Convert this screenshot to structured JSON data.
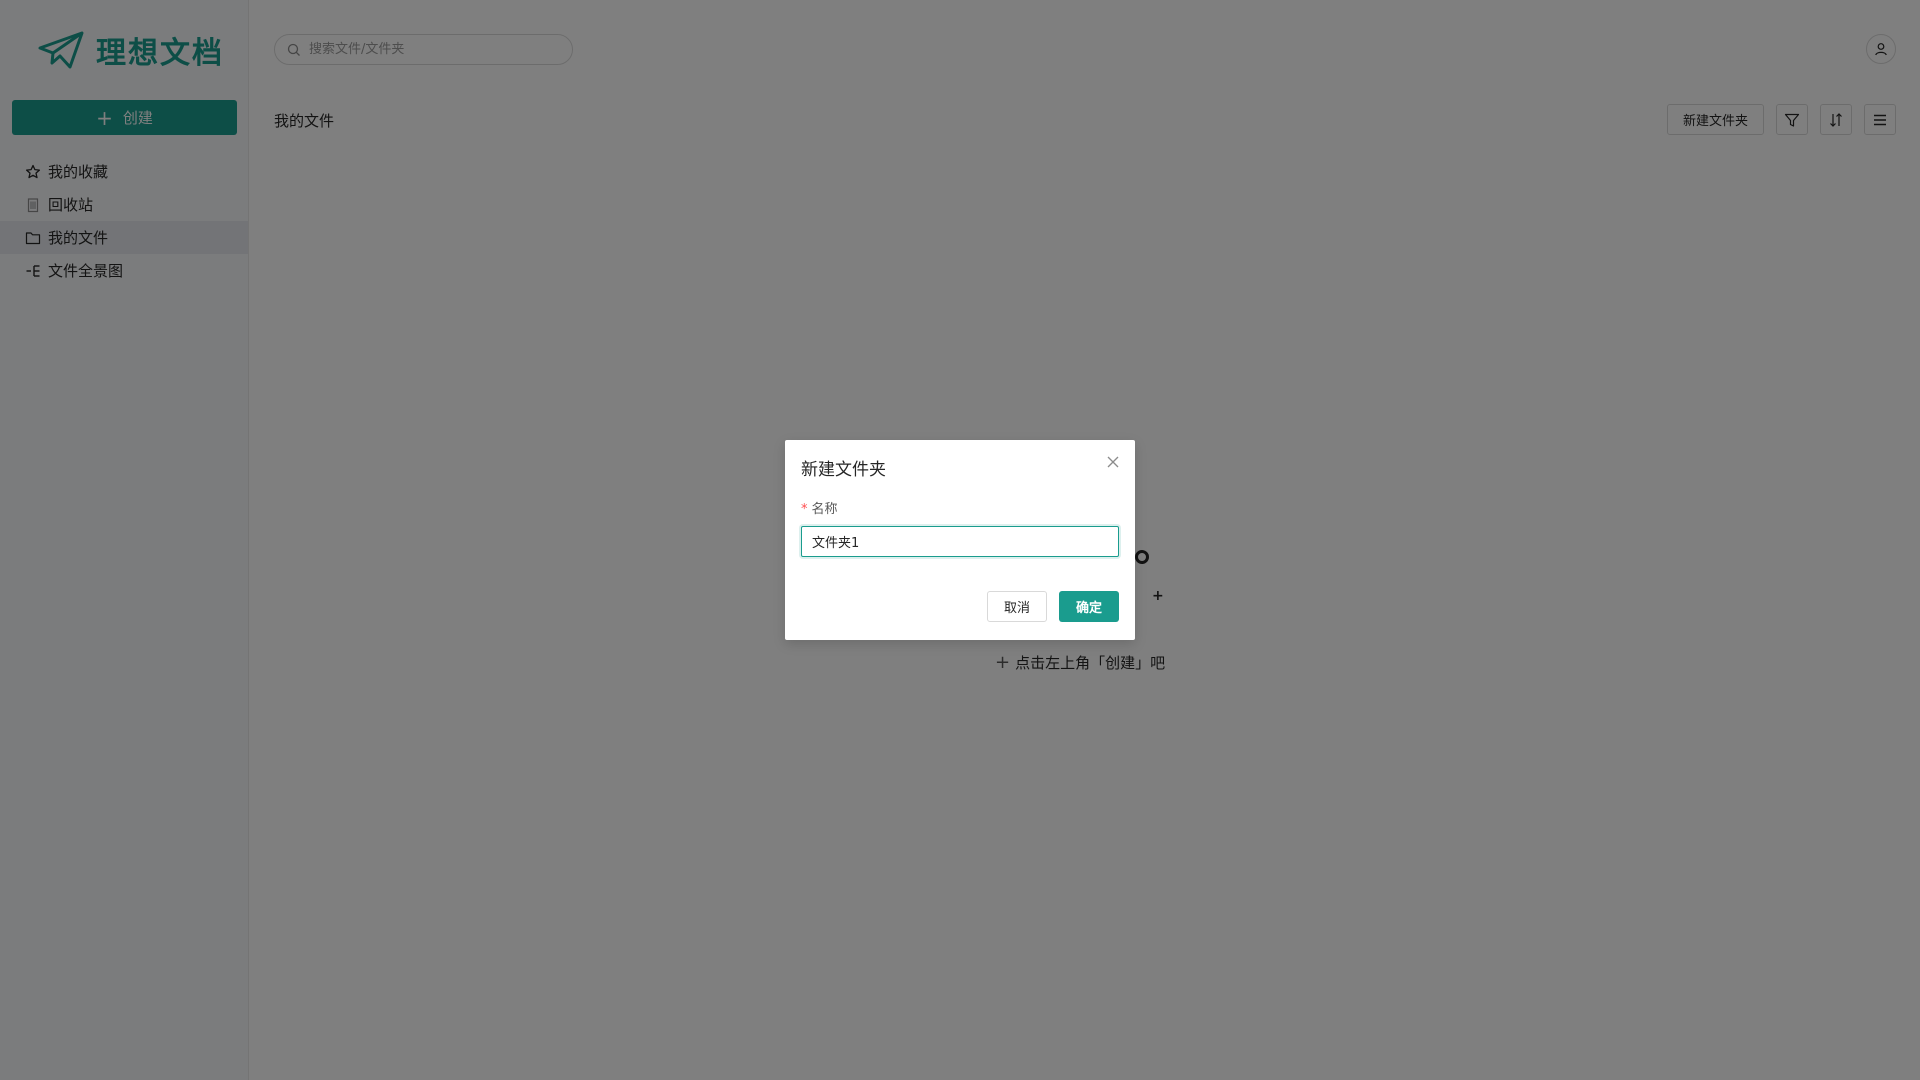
{
  "app": {
    "name": "理想文档",
    "create_label": "创建"
  },
  "sidebar": {
    "items": [
      {
        "label": "我的收藏",
        "icon": "star-icon"
      },
      {
        "label": "回收站",
        "icon": "trash-icon"
      },
      {
        "label": "我的文件",
        "icon": "folder-icon",
        "active": true
      },
      {
        "label": "文件全景图",
        "icon": "tree-icon"
      }
    ]
  },
  "header": {
    "search_placeholder": "搜索文件/文件夹"
  },
  "main": {
    "title": "我的文件",
    "new_folder_label": "新建文件夹",
    "empty_hint": "点击左上角「创建」吧"
  },
  "modal": {
    "title": "新建文件夹",
    "field_label": "名称",
    "field_required_mark": "*",
    "field_value": "文件夹1",
    "cancel_label": "取消",
    "ok_label": "确定"
  },
  "colors": {
    "brand": "#1a9c8e",
    "overlay": "rgba(0,0,0,0.5)"
  }
}
